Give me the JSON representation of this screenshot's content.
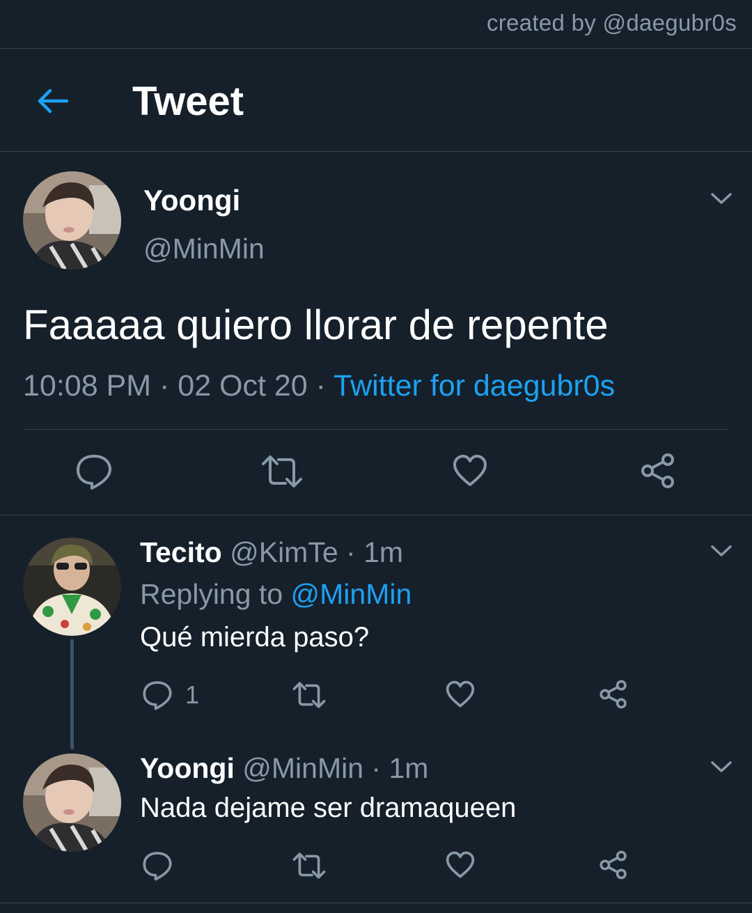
{
  "watermark": "created by @daegubr0s",
  "header": {
    "title": "Tweet"
  },
  "main_tweet": {
    "name": "Yoongi",
    "handle": "@MinMin",
    "text": "Faaaaa quiero llorar de repente",
    "time": "10:08 PM",
    "date": "02 Oct 20",
    "separator": " · ",
    "source": "Twitter for daegubr0s"
  },
  "replies": [
    {
      "name": "Tecito",
      "handle": "@KimTe",
      "time_ago": "1m",
      "replying_prefix": "Replying to ",
      "replying_to": "@MinMin",
      "text": "Qué mierda paso?",
      "reply_count": "1"
    },
    {
      "name": "Yoongi",
      "handle": "@MinMin",
      "time_ago": "1m",
      "text": "Nada dejame ser dramaqueen"
    }
  ],
  "colors": {
    "background": "#15202b",
    "accent": "#1da1f2",
    "secondary_text": "#8899a6",
    "divider": "#38444d"
  },
  "icons": [
    "back-arrow-icon",
    "chevron-down-icon",
    "reply-icon",
    "retweet-icon",
    "like-icon",
    "share-icon"
  ]
}
